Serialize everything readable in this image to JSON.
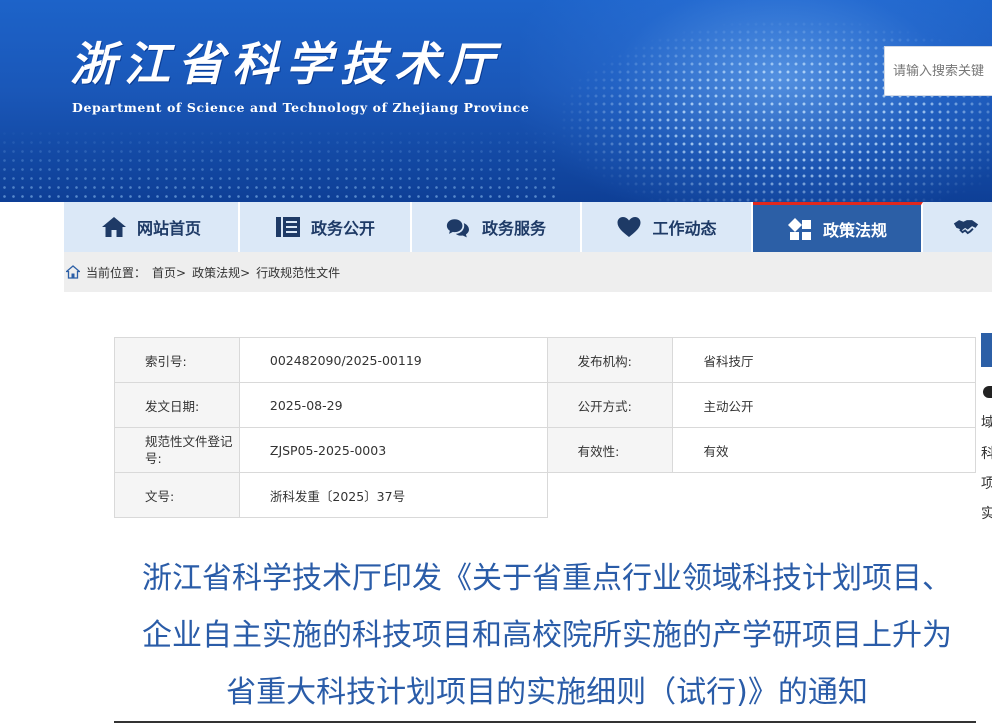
{
  "header": {
    "title": "浙江省科学技术厅",
    "subtitle": "Department of Science and Technology of Zhejiang Province",
    "search_placeholder": "请输入搜索关键"
  },
  "nav": {
    "items": [
      {
        "label": "网站首页",
        "icon": "home-icon"
      },
      {
        "label": "政务公开",
        "icon": "document-list-icon"
      },
      {
        "label": "政务服务",
        "icon": "chat-bubbles-icon"
      },
      {
        "label": "工作动态",
        "icon": "heart-icon"
      },
      {
        "label": "政策法规",
        "icon": "policy-shapes-icon",
        "active": true
      },
      {
        "label": "",
        "icon": "handshake-icon"
      }
    ]
  },
  "breadcrumb": {
    "prefix": "当前位置：",
    "items": [
      "首页>",
      "政策法规>",
      "行政规范性文件"
    ]
  },
  "meta": {
    "rows": [
      [
        {
          "label": "索引号:",
          "value": "002482090/2025-00119"
        },
        {
          "label": "发布机构:",
          "value": "省科技厅"
        }
      ],
      [
        {
          "label": "发文日期:",
          "value": "2025-08-29"
        },
        {
          "label": "公开方式:",
          "value": "主动公开"
        }
      ],
      [
        {
          "label": "规范性文件登记号:",
          "value": "ZJSP05-2025-0003"
        },
        {
          "label": "有效性:",
          "value": "有效"
        }
      ],
      [
        {
          "label": "文号:",
          "value": "浙科发重〔2025〕37号"
        }
      ]
    ]
  },
  "side_panel": {
    "chars": [
      "域",
      "科",
      "项",
      "实"
    ]
  },
  "article": {
    "title_lines": [
      "浙江省科学技术厅印发《关于省重点行业领域科技计划项目、",
      "企业自主实施的科技项目和高校院所实施的产学研项目上升为",
      "省重大科技计划项目的实施细则（试行)》的通知"
    ]
  },
  "colors": {
    "banner_blue": "#1a57b8",
    "nav_bg": "#dbe8f7",
    "nav_active": "#2c5fa6",
    "nav_active_top": "#e0281e",
    "title_blue": "#2a5ca8"
  }
}
